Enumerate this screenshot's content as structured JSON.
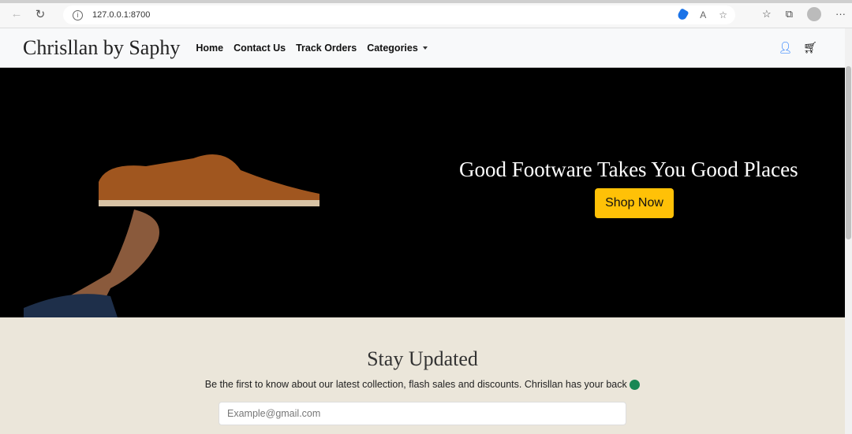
{
  "browser": {
    "url": "127.0.0.1:8700"
  },
  "nav": {
    "brand": "Chrisllan by Saphy",
    "links": [
      "Home",
      "Contact Us",
      "Track Orders",
      "Categories"
    ]
  },
  "hero": {
    "headline": "Good Footware Takes You Good Places",
    "cta": "Shop Now"
  },
  "newsletter": {
    "title": "Stay Updated",
    "text": "Be the first to know about our latest collection, flash sales and discounts. Chrisllan has your back",
    "placeholder": "Example@gmail.com"
  }
}
